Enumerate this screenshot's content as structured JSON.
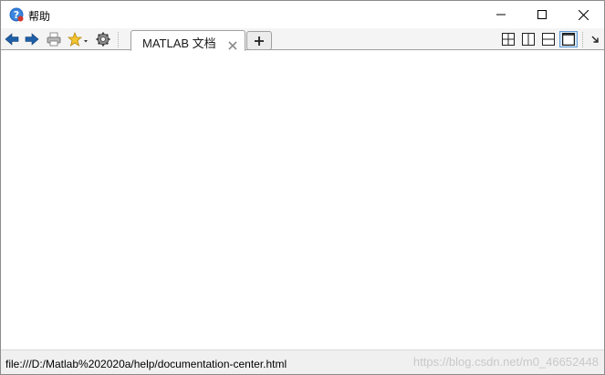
{
  "window": {
    "title": "帮助"
  },
  "toolbar": {
    "back_icon": "back-arrow-icon",
    "forward_icon": "forward-arrow-icon",
    "print_icon": "print-icon",
    "favorites_icon": "star-icon",
    "settings_icon": "gear-icon"
  },
  "tabs": [
    {
      "label": "MATLAB 文档"
    }
  ],
  "layout_buttons": [
    {
      "name": "tile-grid-icon"
    },
    {
      "name": "tile-vertical-icon"
    },
    {
      "name": "tile-horizontal-icon"
    },
    {
      "name": "single-pane-icon",
      "active": true
    }
  ],
  "status": {
    "url": "file:///D:/Matlab%202020a/help/documentation-center.html",
    "watermark": "https://blog.csdn.net/m0_46652448"
  },
  "colors": {
    "accent": "#5e9ad4",
    "arrow_blue": "#1f5fa8",
    "help_icon_blue": "#2a6fc9"
  }
}
